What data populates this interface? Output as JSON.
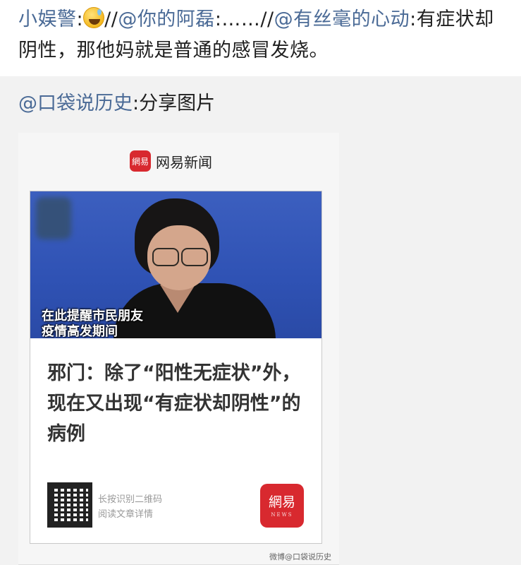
{
  "comment": {
    "user1": "小娱警",
    "sep": ":",
    "sep2": "//",
    "mention1": "@你的阿磊",
    "sep3": ":……",
    "sep4": "//",
    "mention2": "@有丝毫的心动",
    "sep5": ":",
    "text": "有症状却阴性，那他妈就是普通的感冒发烧。",
    "emoji": "grinning-sweat-emoji"
  },
  "repost": {
    "source": "@口袋说历史",
    "suffix": ":分享图片"
  },
  "card": {
    "brand_logo": "網易",
    "brand_name": "网易新闻",
    "video_caption_1": "在此提醒市民朋友",
    "video_caption_2": "疫情高发期间",
    "headline": "邪门：除了“阳性无症状”外，现在又出现“有症状却阴性”的病例",
    "qr_line1": "长按识别二维码",
    "qr_line2": "阅读文章详情",
    "logo_line1": "網易",
    "logo_line2": "NEWS",
    "watermark": "微博@口袋说历史"
  },
  "colors": {
    "link": "#4a6a96",
    "brand_red": "#d8292f",
    "repost_bg": "#f2f2f2"
  }
}
